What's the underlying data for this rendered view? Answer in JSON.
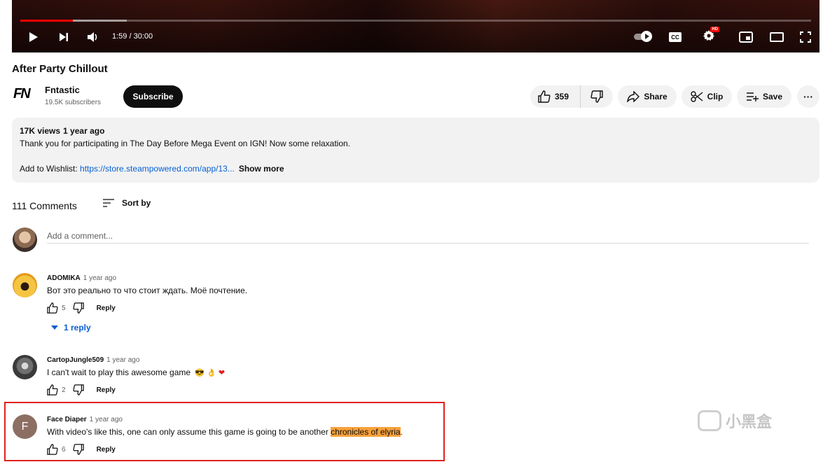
{
  "player": {
    "time": "1:59 / 30:00",
    "progress_fraction": 0.066,
    "buffered_fraction": 0.135
  },
  "video": {
    "title": "After Party Chillout"
  },
  "channel": {
    "logo": "FN",
    "name": "Fntastic",
    "subscribers": "19.5K subscribers",
    "subscribe_label": "Subscribe"
  },
  "actions": {
    "likes": "359",
    "share_label": "Share",
    "clip_label": "Clip",
    "save_label": "Save",
    "more_label": "···"
  },
  "description": {
    "views": "17K views",
    "age": "1 year ago",
    "line1": "Thank you for participating in The Day Before Mega Event on IGN! Now some relaxation.",
    "wishlist_prefix": "Add to Wishlist: ",
    "link": "https://store.steampowered.com/app/13...",
    "show_more": "Show more"
  },
  "comments": {
    "count_label": "111 Comments",
    "sort_label": "Sort by",
    "add_placeholder": "Add a comment...",
    "items": [
      {
        "author": "ADOMIKA",
        "time": "1 year ago",
        "text": "Вот это реально то что стоит ждать. Моё почтение.",
        "likes": "5",
        "reply_label": "Reply",
        "replies_label": "1 reply"
      },
      {
        "author": "CartopJungle509",
        "time": "1 year ago",
        "text": "I can't wait to play this awesome game",
        "likes": "2",
        "reply_label": "Reply"
      },
      {
        "author": "Face Diaper",
        "time": "1 year ago",
        "avatar_letter": "F",
        "text_before": "With video's like this, one can only assume this game is going to be another ",
        "text_highlight": "chronicles of elyria",
        "text_after": ".",
        "likes": "6",
        "reply_label": "Reply"
      }
    ]
  },
  "watermark": {
    "text": "小黑盒"
  },
  "colors": {
    "accent_link": "#065fd4",
    "progress_red": "#ff0000",
    "highlight": "#f7a13b",
    "frame_red": "#e0201e"
  }
}
